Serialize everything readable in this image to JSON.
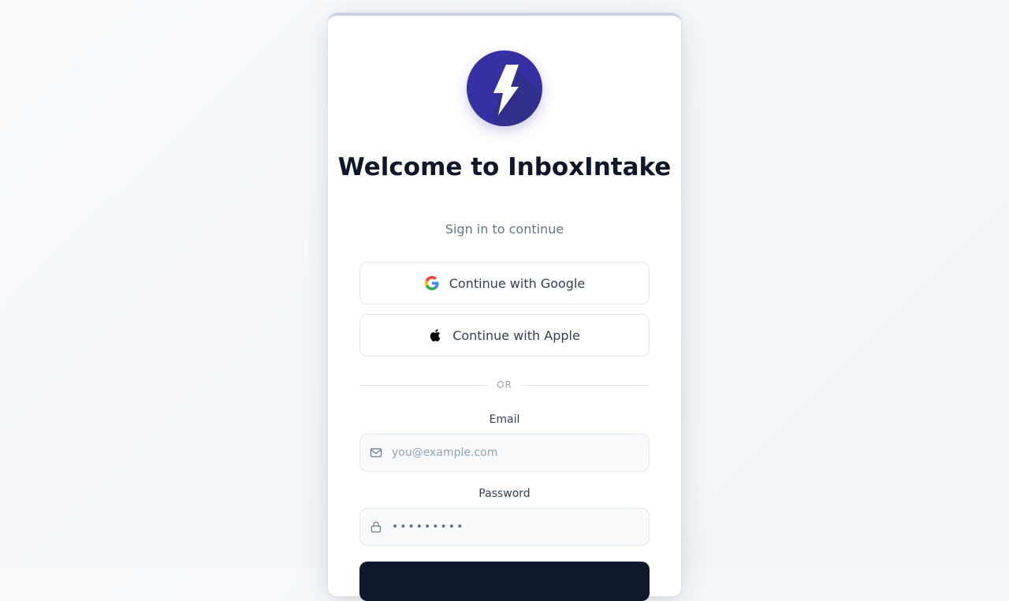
{
  "app": {
    "title": "Welcome to InboxIntake",
    "subtitle": "Sign in to continue",
    "brand_color": "#3730a3"
  },
  "auth": {
    "google_label": "Continue with Google",
    "apple_label": "Continue with Apple",
    "divider_label": "OR"
  },
  "form": {
    "email_label": "Email",
    "email_placeholder": "you@example.com",
    "email_value": "",
    "password_label": "Password",
    "password_value": "password1"
  },
  "icons": {
    "logo": "lightning-bolt-icon",
    "google": "google-icon",
    "apple": "apple-icon",
    "email": "mail-icon",
    "password": "lock-icon"
  }
}
